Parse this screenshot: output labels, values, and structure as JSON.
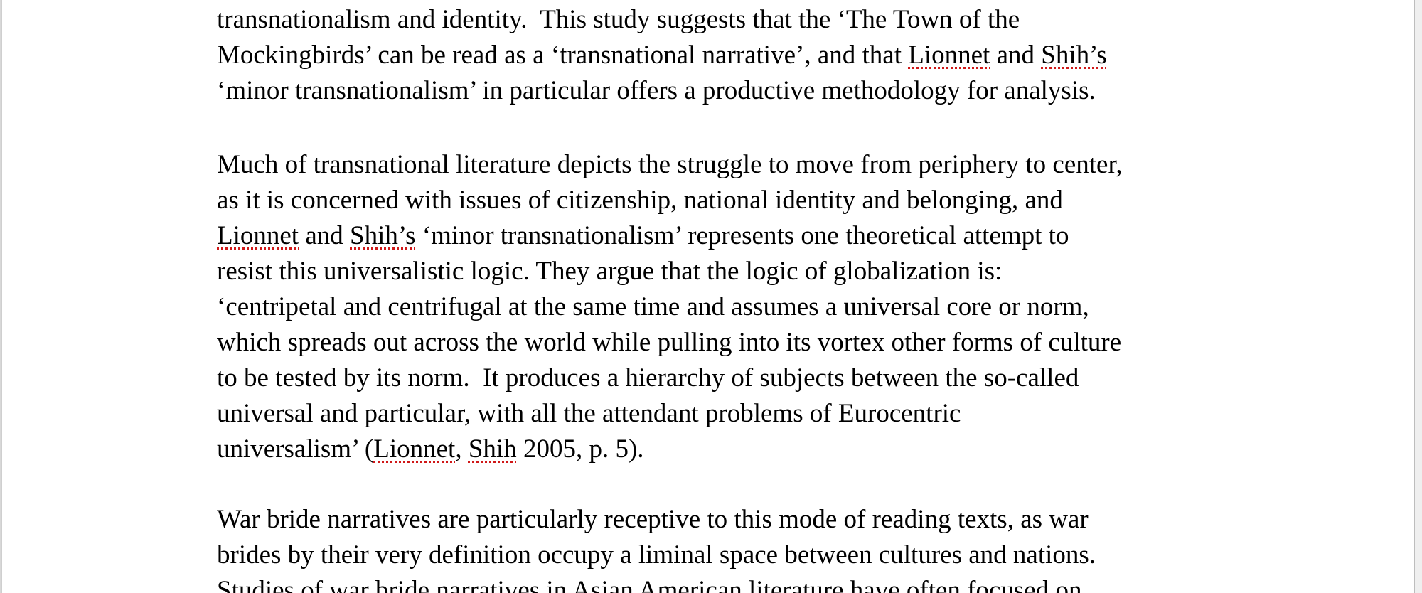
{
  "document": {
    "paragraphs": [
      {
        "lines": [
          [
            {
              "t": "transnationalism and identity.  This study suggests that the ‘The Town of the"
            }
          ],
          [
            {
              "t": "Mockingbirds’ can be read as a ‘transnational narrative’, and that "
            },
            {
              "t": "Lionnet",
              "s": 1
            },
            {
              "t": " and "
            },
            {
              "t": "Shih’s",
              "s": 1
            }
          ],
          [
            {
              "t": "‘minor transnationalism’ in particular offers a productive methodology for analysis."
            }
          ]
        ]
      },
      {
        "lines": [
          [
            {
              "t": "Much of transnational literature depicts the struggle to move from periphery to center,"
            }
          ],
          [
            {
              "t": "as it is concerned with issues of citizenship, national identity and belonging, and"
            }
          ],
          [
            {
              "t": "Lionnet",
              "s": 1
            },
            {
              "t": " and "
            },
            {
              "t": "Shih’s",
              "s": 1
            },
            {
              "t": " ‘minor transnationalism’ represents one theoretical attempt to"
            }
          ],
          [
            {
              "t": "resist this universalistic logic. They argue that the logic of globalization is:"
            }
          ],
          [
            {
              "t": "‘centripetal and centrifugal at the same time and assumes a universal core or norm,"
            }
          ],
          [
            {
              "t": "which spreads out across the world while pulling into its vortex other forms of culture"
            }
          ],
          [
            {
              "t": "to be tested by its norm.  It produces a hierarchy of subjects between the so-called"
            }
          ],
          [
            {
              "t": "universal and particular, with all the attendant problems of Eurocentric"
            }
          ],
          [
            {
              "t": "universalism’ ("
            },
            {
              "t": "Lionnet",
              "s": 1
            },
            {
              "t": ", "
            },
            {
              "t": "Shih",
              "s": 1
            },
            {
              "t": " 2005, p. 5)."
            }
          ]
        ]
      },
      {
        "lines": [
          [
            {
              "t": "War bride narratives are particularly receptive to this mode of reading texts, as war"
            }
          ],
          [
            {
              "t": "brides by their very definition occupy a liminal space between cultures and nations."
            }
          ],
          [
            {
              "t": "Studies of war bride narratives in Asian American literature have often focused on"
            }
          ]
        ]
      }
    ]
  },
  "colors": {
    "page": "#ffffff",
    "text": "#000000",
    "spellcheck_underline": "#d01818"
  }
}
